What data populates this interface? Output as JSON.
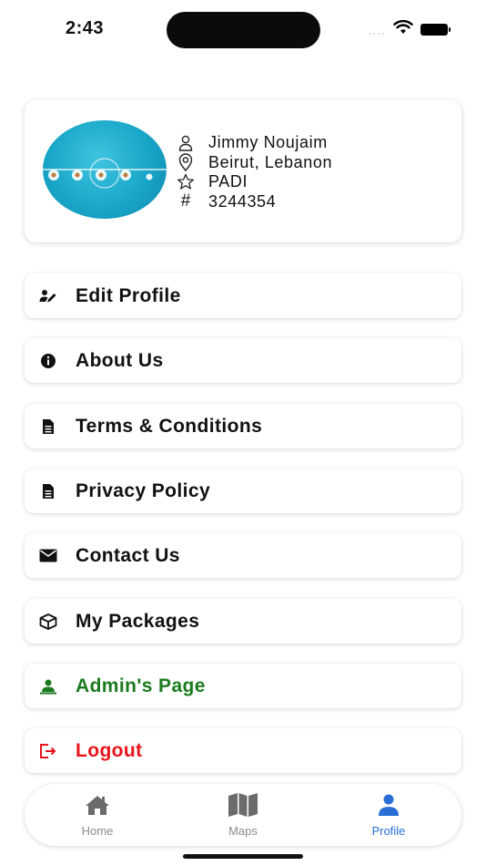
{
  "status_bar": {
    "time": "2:43",
    "signal": "....",
    "icons": [
      "signal-dots-icon",
      "wifi-icon",
      "battery-icon"
    ]
  },
  "profile": {
    "name": "Jimmy Noujaim",
    "location": "Beirut, Lebanon",
    "agency": "PADI",
    "number_symbol": "#",
    "number": "3244354",
    "avatar_color": "#18a6c8"
  },
  "menu": [
    {
      "label": "Edit Profile",
      "icon": "edit-user-icon",
      "color": "#111111"
    },
    {
      "label": "About Us",
      "icon": "info-icon",
      "color": "#111111"
    },
    {
      "label": "Terms & Conditions",
      "icon": "document-icon",
      "color": "#111111"
    },
    {
      "label": "Privacy Policy",
      "icon": "document-icon",
      "color": "#111111"
    },
    {
      "label": "Contact Us",
      "icon": "envelope-icon",
      "color": "#111111"
    },
    {
      "label": "My Packages",
      "icon": "package-icon",
      "color": "#111111"
    },
    {
      "label": "Admin's Page",
      "icon": "admin-user-icon",
      "color": "#1a7a1e"
    },
    {
      "label": "Logout",
      "icon": "logout-icon",
      "color": "#e8141c"
    }
  ],
  "tabs": [
    {
      "label": "Home",
      "icon": "home-icon",
      "active": false
    },
    {
      "label": "Maps",
      "icon": "map-icon",
      "active": false
    },
    {
      "label": "Profile",
      "icon": "user-icon",
      "active": true
    }
  ],
  "colors": {
    "active_tab": "#2a6fd6",
    "inactive_tab": "#8a8a8a",
    "admin": "#1a7a1e",
    "logout": "#e8141c"
  }
}
